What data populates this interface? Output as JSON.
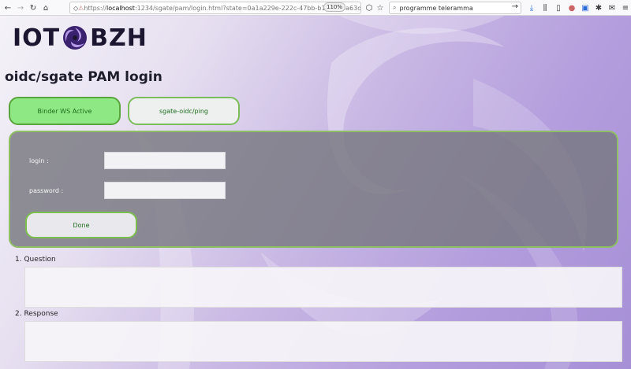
{
  "browser": {
    "url_proto": "https://",
    "url_host": "localhost",
    "url_rest": ":1234/sgate/pam/login.html?state=0a1a229e-222c-47bb-b12f-53ba63d",
    "zoom": "110%",
    "search_value": "programme teleramma",
    "icons": [
      "back-arrow-icon",
      "forward-arrow-icon",
      "reload-icon",
      "home-icon",
      "shield-icon",
      "lock-warning-icon",
      "pocket-icon",
      "star-icon",
      "search-go-icon",
      "download-icon",
      "library-icon",
      "sidebar-icon",
      "profile-icon",
      "extension-icon",
      "puzzle-icon",
      "mail-icon",
      "menu-icon"
    ]
  },
  "logo": {
    "left": "IOT",
    "right": "BZH"
  },
  "page": {
    "title": "oidc/sgate PAM login"
  },
  "buttons": {
    "binder": "Binder WS Active",
    "ping": "sgate-oidc/ping",
    "done": "Done"
  },
  "form": {
    "login_label": "login :",
    "password_label": "password :",
    "login_value": "",
    "password_value": ""
  },
  "sections": {
    "question": "1. Question",
    "response": "2. Response"
  },
  "colors": {
    "active_green": "#8ee883",
    "border_green": "#7cbf4e",
    "panel_gray": "#78787f",
    "bg_purple": "#b39ddd"
  }
}
